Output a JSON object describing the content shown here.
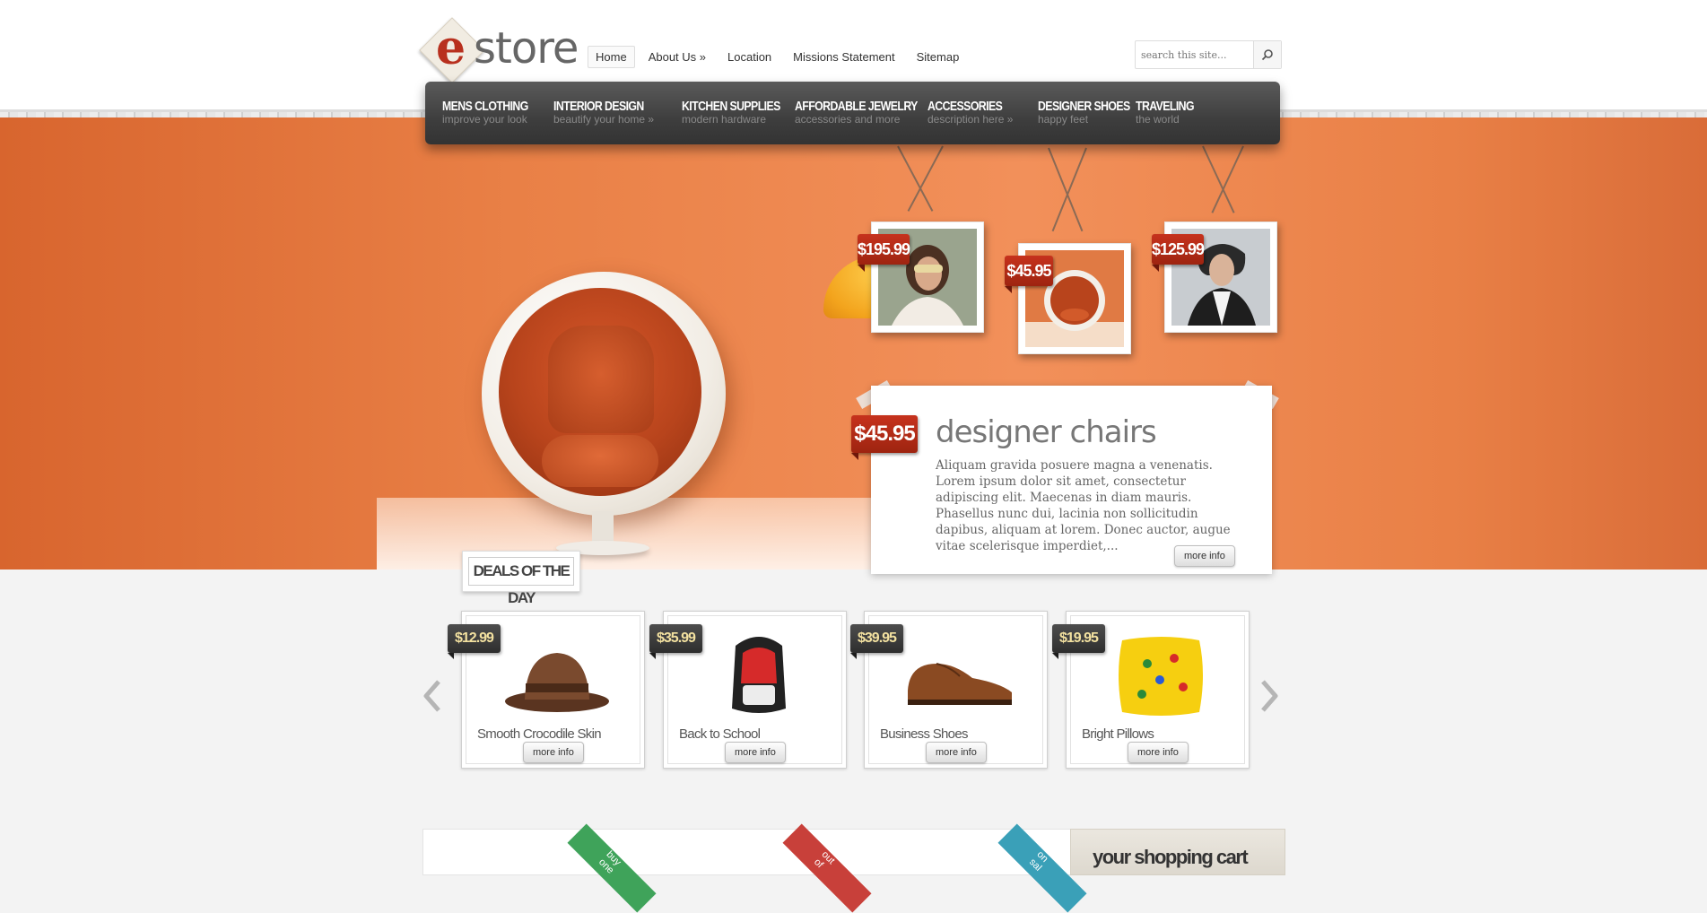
{
  "brand": {
    "logo_letter": "e",
    "logo_word": "store"
  },
  "topnav": [
    "Home",
    "About Us »",
    "Location",
    "Missions Statement",
    "Sitemap"
  ],
  "search": {
    "placeholder": "search this site..."
  },
  "mainnav": [
    {
      "title": "MENS CLOTHING",
      "sub": "improve your look"
    },
    {
      "title": "INTERIOR DESIGN",
      "sub": "beautify your home »"
    },
    {
      "title": "KITCHEN SUPPLIES",
      "sub": "modern hardware"
    },
    {
      "title": "AFFORDABLE JEWELRY",
      "sub": "accessories and more"
    },
    {
      "title": "ACCESSORIES",
      "sub": "description here »"
    },
    {
      "title": "DESIGNER SHOES",
      "sub": "happy feet"
    },
    {
      "title": "TRAVELING",
      "sub": "the world"
    }
  ],
  "hero_frames": [
    {
      "price": "$195.99",
      "subject": "woman-with-mask"
    },
    {
      "price": "$45.95",
      "subject": "pod-chair"
    },
    {
      "price": "$125.99",
      "subject": "man-portrait"
    }
  ],
  "feature": {
    "price": "$45.95",
    "title": "designer chairs",
    "text": "Aliquam gravida posuere magna a venenatis. Lorem ipsum dolor sit amet, consectetur adipiscing elit. Maecenas in diam mauris. Phasellus nunc dui, lacinia non sollicitudin dapibus, aliquam at lorem. Donec auctor, augue vitae scelerisque imperdiet,...",
    "button": "more info"
  },
  "deals": {
    "label": "DEALS OF THE DAY",
    "items": [
      {
        "price": "$12.99",
        "name": "Smooth Crocodile Skin",
        "button": "more info"
      },
      {
        "price": "$35.99",
        "name": "Back to School",
        "button": "more info"
      },
      {
        "price": "$39.95",
        "name": "Business Shoes",
        "button": "more info"
      },
      {
        "price": "$19.95",
        "name": "Bright Pillows",
        "button": "more info"
      }
    ]
  },
  "ribbons": [
    "buy one",
    "out of",
    "on sal"
  ],
  "cart": {
    "title": "your shopping cart"
  },
  "colors": {
    "hero_orange": "#e98046",
    "price_red": "#b02a16",
    "nav_dark": "#3e3e3e",
    "ribbon_green": "#3fa35a",
    "ribbon_red": "#c8403a",
    "ribbon_blue": "#3aa0b8"
  }
}
